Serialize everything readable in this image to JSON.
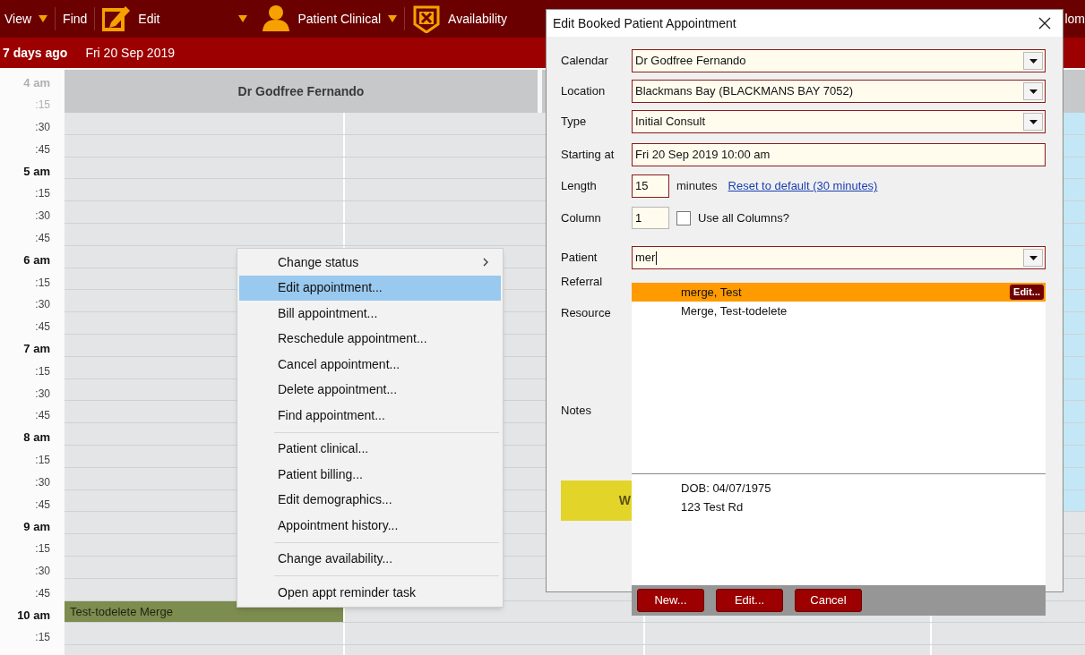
{
  "toolbar": {
    "items": [
      {
        "label": "View",
        "dropdown": true
      },
      {
        "label": "Find",
        "dropdown": false
      },
      {
        "label": "Edit",
        "dropdown": true
      },
      {
        "label": "Patient Clinical",
        "dropdown": true
      },
      {
        "label": "Availability",
        "dropdown": false
      }
    ],
    "cut_label": "lom"
  },
  "date_bar": {
    "relative": "7 days ago",
    "date": "Fri 20 Sep 2019"
  },
  "calendar": {
    "column_header": "Dr Godfree Fernando",
    "times": [
      {
        "label": "4 am",
        "major": true,
        "dimmed": true
      },
      {
        "label": ":15",
        "major": false,
        "dimmed": true
      },
      {
        "label": ":30",
        "major": false,
        "dimmed": false
      },
      {
        "label": ":45",
        "major": false,
        "dimmed": false
      },
      {
        "label": "5 am",
        "major": true,
        "dimmed": false
      },
      {
        "label": ":15",
        "major": false,
        "dimmed": false
      },
      {
        "label": ":30",
        "major": false,
        "dimmed": false
      },
      {
        "label": ":45",
        "major": false,
        "dimmed": false
      },
      {
        "label": "6 am",
        "major": true,
        "dimmed": false
      },
      {
        "label": ":15",
        "major": false,
        "dimmed": false
      },
      {
        "label": ":30",
        "major": false,
        "dimmed": false
      },
      {
        "label": ":45",
        "major": false,
        "dimmed": false
      },
      {
        "label": "7 am",
        "major": true,
        "dimmed": false
      },
      {
        "label": ":15",
        "major": false,
        "dimmed": false
      },
      {
        "label": ":30",
        "major": false,
        "dimmed": false
      },
      {
        "label": ":45",
        "major": false,
        "dimmed": false
      },
      {
        "label": "8 am",
        "major": true,
        "dimmed": false
      },
      {
        "label": ":15",
        "major": false,
        "dimmed": false
      },
      {
        "label": ":30",
        "major": false,
        "dimmed": false
      },
      {
        "label": ":45",
        "major": false,
        "dimmed": false
      },
      {
        "label": "9 am",
        "major": true,
        "dimmed": false
      },
      {
        "label": ":15",
        "major": false,
        "dimmed": false
      },
      {
        "label": ":30",
        "major": false,
        "dimmed": false
      },
      {
        "label": ":45",
        "major": false,
        "dimmed": false
      },
      {
        "label": "10 am",
        "major": true,
        "dimmed": false,
        "appointment": "Test-todelete Merge"
      },
      {
        "label": ":15",
        "major": false,
        "dimmed": false
      }
    ]
  },
  "context_menu": {
    "items": [
      {
        "kind": "item",
        "label": "Change status",
        "submenu": true,
        "selected": false
      },
      {
        "kind": "item",
        "label": "Edit appointment...",
        "submenu": false,
        "selected": true
      },
      {
        "kind": "item",
        "label": "Bill appointment...",
        "submenu": false,
        "selected": false
      },
      {
        "kind": "item",
        "label": "Reschedule appointment...",
        "submenu": false,
        "selected": false
      },
      {
        "kind": "item",
        "label": "Cancel appointment...",
        "submenu": false,
        "selected": false
      },
      {
        "kind": "item",
        "label": "Delete appointment...",
        "submenu": false,
        "selected": false
      },
      {
        "kind": "item",
        "label": "Find appointment...",
        "submenu": false,
        "selected": false
      },
      {
        "kind": "separator"
      },
      {
        "kind": "item",
        "label": "Patient clinical...",
        "submenu": false,
        "selected": false
      },
      {
        "kind": "item",
        "label": "Patient billing...",
        "submenu": false,
        "selected": false
      },
      {
        "kind": "item",
        "label": "Edit demographics...",
        "submenu": false,
        "selected": false
      },
      {
        "kind": "item",
        "label": "Appointment history...",
        "submenu": false,
        "selected": false
      },
      {
        "kind": "separator"
      },
      {
        "kind": "item",
        "label": "Change availability...",
        "submenu": false,
        "selected": false
      },
      {
        "kind": "separator"
      },
      {
        "kind": "item",
        "label": "Open appt reminder task",
        "submenu": false,
        "selected": false
      }
    ]
  },
  "dialog": {
    "title": "Edit Booked Patient Appointment",
    "fields": [
      {
        "kind": "dropdown",
        "label": "Calendar",
        "value": "Dr Godfree Fernando"
      },
      {
        "kind": "dropdown",
        "label": "Location",
        "value": "Blackmans Bay (BLACKMANS BAY 7052)"
      },
      {
        "kind": "dropdown",
        "label": "Type",
        "value": "Initial Consult"
      },
      {
        "kind": "text",
        "label": "Starting at",
        "value": "Fri 20 Sep 2019 10:00 am"
      },
      {
        "kind": "length",
        "label": "Length",
        "value": "15",
        "suffix": "minutes",
        "link": "Reset to default (30 minutes)"
      },
      {
        "kind": "column",
        "label": "Column",
        "value": "1",
        "checkbox": {
          "label": "Use all Columns?",
          "checked": false
        }
      },
      {
        "kind": "combo",
        "label": "Patient",
        "value": "mer"
      },
      {
        "kind": "label",
        "label": "Referral"
      },
      {
        "kind": "label",
        "label": "Resource"
      },
      {
        "kind": "label",
        "label": "Notes"
      }
    ],
    "status_block": "W",
    "patient_dropdown": {
      "results": [
        {
          "name": "merge, Test",
          "selected": true,
          "edit": "Edit..."
        },
        {
          "name": "Merge, Test-todelete",
          "selected": false
        }
      ],
      "details": [
        "DOB: 04/07/1975",
        "123 Test Rd"
      ],
      "buttons": [
        "New...",
        "Edit...",
        "Cancel"
      ]
    }
  }
}
